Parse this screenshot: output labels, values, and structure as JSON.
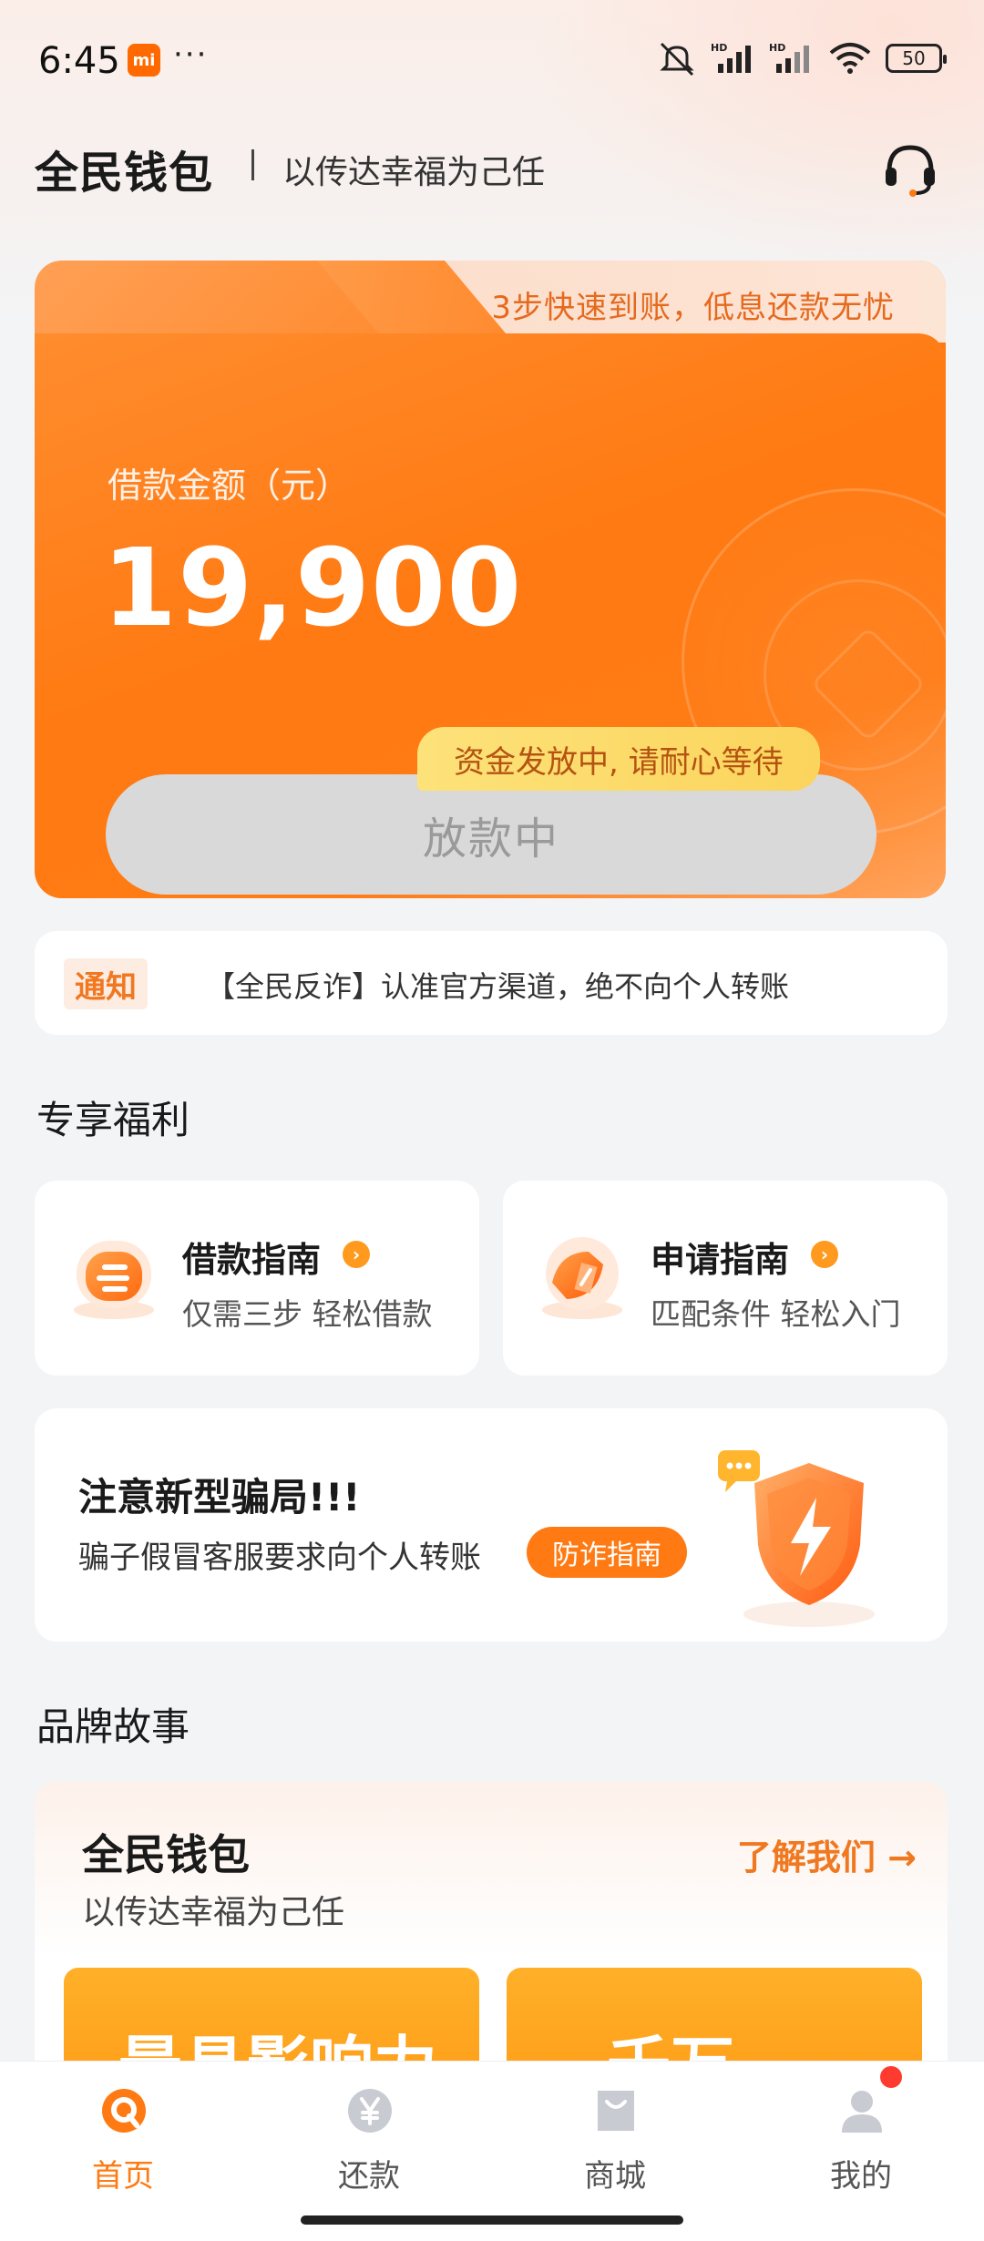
{
  "status_bar": {
    "time": "6:45",
    "mi_badge": "mi",
    "more": "···",
    "battery": "50",
    "icons": [
      "mute-icon",
      "signal-hd-1-icon",
      "signal-hd-2-icon",
      "wifi-icon",
      "battery-icon"
    ]
  },
  "header": {
    "brand": "全民钱包",
    "slogan": "以传达幸福为己任",
    "service_icon": "headset-icon"
  },
  "loan_card": {
    "tagline": "3步快速到账，低息还款无忧",
    "amount_label": "借款金额（元）",
    "amount_value": "19,900",
    "status_tip": "资金发放中, 请耐心等待",
    "button_label": "放款中"
  },
  "notice": {
    "tag": "通知",
    "text": "【全民反诈】认准官方渠道，绝不向个人转账"
  },
  "benefits": {
    "title": "专享福利",
    "cards": [
      {
        "title": "借款指南",
        "sub": "仅需三步 轻松借款"
      },
      {
        "title": "申请指南",
        "sub": "匹配条件 轻松入门"
      }
    ]
  },
  "fraud": {
    "title": "注意新型骗局!!!",
    "sub": "骗子假冒客服要求向个人转账",
    "button": "防诈指南"
  },
  "brand_story": {
    "title": "品牌故事",
    "card_title": "全民钱包",
    "card_sub": "以传达幸福为己任",
    "link": "了解我们 →",
    "banners": [
      "最具影响力",
      "千万"
    ]
  },
  "nav": {
    "items": [
      {
        "label": "首页",
        "icon": "home-icon",
        "active": true
      },
      {
        "label": "还款",
        "icon": "yen-icon",
        "active": false
      },
      {
        "label": "商城",
        "icon": "shopping-bag-icon",
        "active": false
      },
      {
        "label": "我的",
        "icon": "profile-icon",
        "active": false
      }
    ]
  },
  "colors": {
    "accent": "#ff7a12",
    "accent_light": "#ff9a3c",
    "tip_yellow": "#fbd45c",
    "button_disabled": "#d9d9d9"
  }
}
